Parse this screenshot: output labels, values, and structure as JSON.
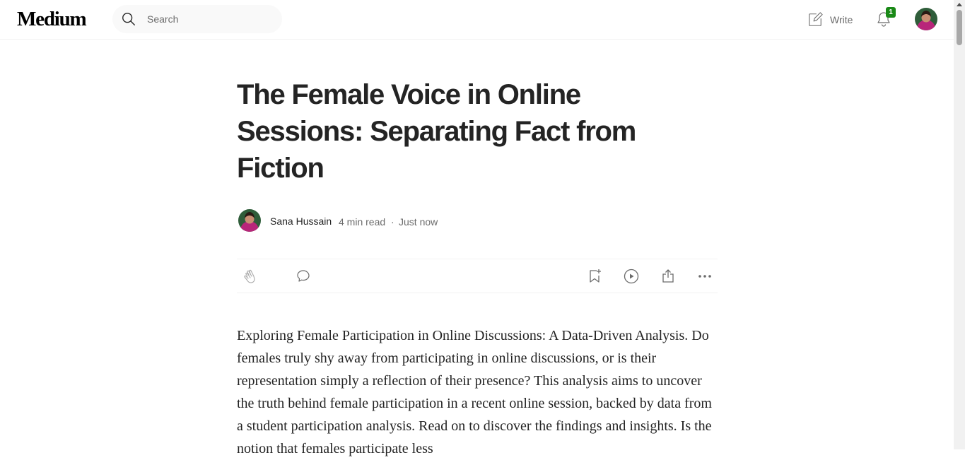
{
  "header": {
    "logo": "Medium",
    "search_placeholder": "Search",
    "write_label": "Write",
    "notification_count": "1"
  },
  "article": {
    "title": "The Female Voice in Online Sessions: Separating Fact from Fiction",
    "author": "Sana Hussain",
    "read_time": "4 min read",
    "separator": "·",
    "published": "Just now",
    "body": "Exploring Female Participation in Online Discussions: A Data-Driven Analysis. Do females truly shy away from participating in online discussions, or is their representation simply a reflection of their presence? This analysis aims to uncover the truth behind female participation in a recent online session, backed by data from a student participation analysis. Read on to discover the findings and insights. Is the notion that females participate less"
  },
  "actions": {
    "icons": [
      "clap-icon",
      "comment-icon",
      "bookmark-add-icon",
      "play-icon",
      "share-icon",
      "more-icon"
    ]
  },
  "colors": {
    "text": "#242424",
    "muted": "#6b6b6b",
    "badge": "#1a8917",
    "search_bg": "#f9f9f9"
  }
}
